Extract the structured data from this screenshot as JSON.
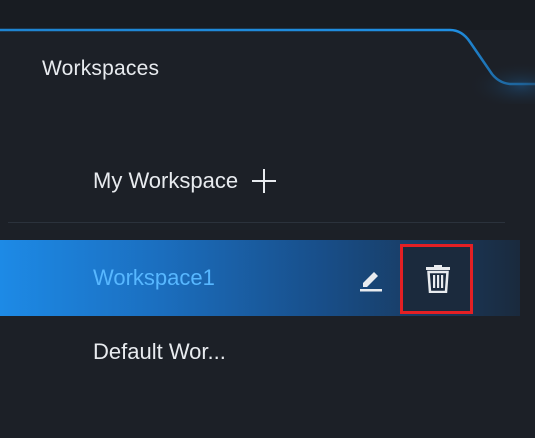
{
  "panel": {
    "tab_title": "Workspaces"
  },
  "section": {
    "label": "My Workspace",
    "add_icon": "plus-icon"
  },
  "workspaces": [
    {
      "label": "Workspace1",
      "selected": true,
      "edit_icon": "pencil-icon",
      "delete_icon": "trash-icon"
    },
    {
      "label": "Default Wor...",
      "selected": false
    }
  ],
  "colors": {
    "background": "#1c2027",
    "tab_accent": "#1f8fe3",
    "selected_text": "#57b7ff",
    "highlight_border": "#e32024",
    "text": "#e8ebef"
  }
}
